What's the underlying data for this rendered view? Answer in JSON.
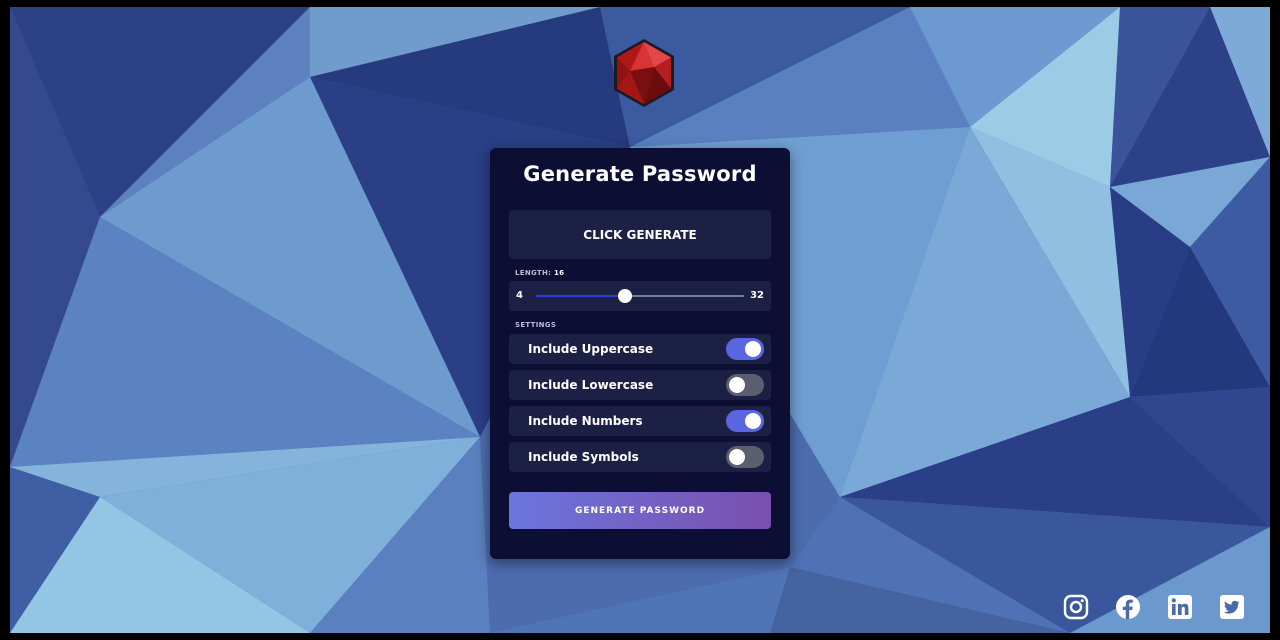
{
  "app": {
    "title": "Generate Password",
    "result_placeholder": "CLICK GENERATE",
    "length_label": "LENGTH:",
    "length_value": "16",
    "slider": {
      "min_label": "4",
      "max_label": "32",
      "min": 4,
      "max": 32,
      "value": 16
    },
    "settings_label": "SETTINGS",
    "settings": [
      {
        "label": "Include Uppercase",
        "enabled": true
      },
      {
        "label": "Include Lowercase",
        "enabled": false
      },
      {
        "label": "Include Numbers",
        "enabled": true
      },
      {
        "label": "Include Symbols",
        "enabled": false
      }
    ],
    "generate_button_label": "GENERATE PASSWORD"
  },
  "icons": {
    "logo": "red-gem-logo",
    "social": [
      "instagram-icon",
      "facebook-icon",
      "linkedin-icon",
      "twitter-icon"
    ]
  },
  "colors": {
    "card": "#0c0e33",
    "panel": "#1d2045",
    "toggle_on": "#5a66e0",
    "toggle_off": "#5a5e6e",
    "button_gradient_start": "#6b76dc",
    "button_gradient_end": "#7a4fae",
    "logo_red": "#d42a2a"
  }
}
